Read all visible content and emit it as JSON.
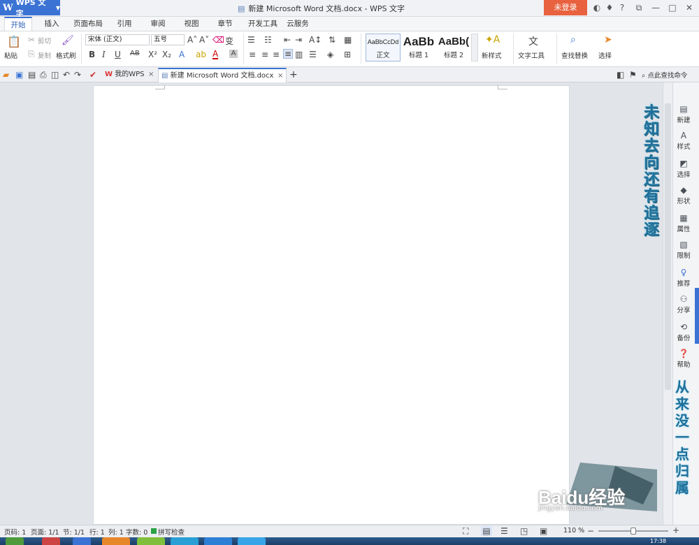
{
  "app": {
    "logo": "WPS 文字",
    "title": "新建 Microsoft Word 文档.docx - WPS 文字",
    "login": "未登录"
  },
  "menu_tabs": [
    "开始",
    "插入",
    "页面布局",
    "引用",
    "审阅",
    "视图",
    "章节",
    "开发工具",
    "云服务"
  ],
  "ribbon": {
    "paste": "粘贴",
    "cut": "剪切",
    "copy": "复制",
    "format_painter": "格式刷",
    "font_name": "宋体 (正文)",
    "font_size": "五号",
    "styles": [
      {
        "preview": "AaBbCcDd",
        "name": "正文"
      },
      {
        "preview": "AaBb",
        "name": "标题 1"
      },
      {
        "preview": "AaBb(",
        "name": "标题 2"
      }
    ],
    "new_style": "新样式",
    "text_tools": "文字工具",
    "find_replace": "查找替换",
    "select": "选择"
  },
  "doc_tabs": [
    {
      "label": "我的WPS"
    },
    {
      "label": "新建 Microsoft Word 文档.docx"
    }
  ],
  "search_command": "点此查找命令",
  "sidebar": [
    "新建",
    "样式",
    "选择",
    "形状",
    "属性",
    "限制",
    "推荐",
    "分享",
    "备份",
    "帮助"
  ],
  "overlay": {
    "vertical_text_1": "未知去向还有追逐",
    "vertical_text_2": "从来没一点归属",
    "watermark": "Baidu经验",
    "watermark_url": "jingyan.baidu.com"
  },
  "status": {
    "page": "页码: 1",
    "pages": "页面: 1/1",
    "section": "节: 1/1",
    "row": "行: 1",
    "col": "列: 1",
    "words": "字数: 0",
    "spell": "拼写检查",
    "zoom": "110 %",
    "time": "17:38"
  },
  "colors": {
    "accent": "#3b73d4",
    "login": "#e8623f"
  }
}
